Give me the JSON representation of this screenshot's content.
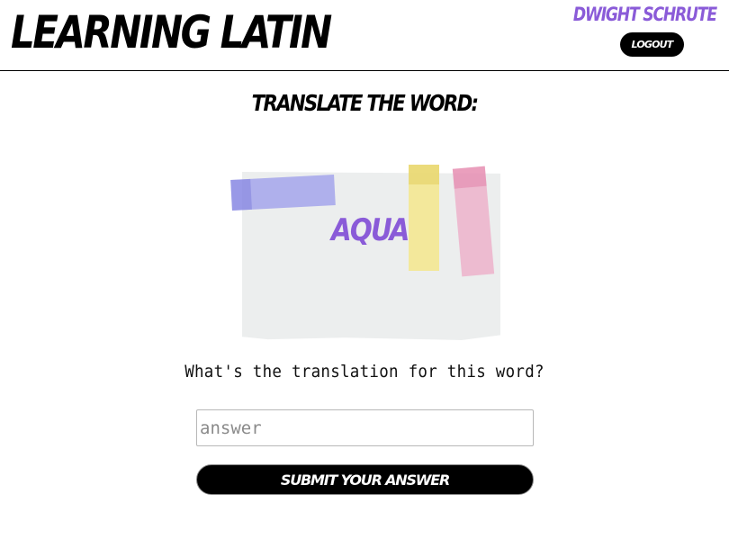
{
  "header": {
    "app_title": "Learning Latin",
    "user_name": "Dwight Schrute",
    "logout_label": "Logout"
  },
  "main": {
    "prompt_heading": "Translate the word:",
    "word": "AQUA",
    "question": "What's the translation for this word?",
    "answer_placeholder": "answer",
    "answer_value": "",
    "submit_label": "Submit your answer"
  },
  "colors": {
    "accent_purple": "#8a5bd8",
    "tape_blue": "#9696eb",
    "tape_yellow": "#f5e68c",
    "tape_pink": "#eea5c3",
    "paper": "#eceeee"
  }
}
